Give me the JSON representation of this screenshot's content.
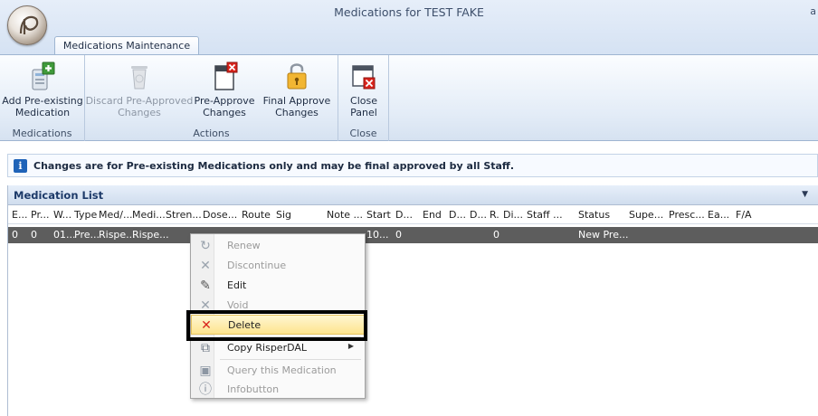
{
  "window": {
    "title": "Medications for TEST FAKE",
    "right_glyph": "a"
  },
  "tabs": [
    {
      "label": "Medications Maintenance"
    }
  ],
  "ribbon": {
    "groups": [
      {
        "label": "Medications",
        "buttons": [
          {
            "label_line1": "Add Pre-existing",
            "label_line2": "Medication",
            "icon": "add-medication-icon",
            "enabled": true
          }
        ]
      },
      {
        "label": "Actions",
        "buttons": [
          {
            "label_line1": "Discard Pre-Approved",
            "label_line2": "Changes",
            "icon": "trash-icon",
            "enabled": false
          },
          {
            "label_line1": "Pre-Approve",
            "label_line2": "Changes",
            "icon": "document-x-icon",
            "enabled": true
          },
          {
            "label_line1": "Final Approve",
            "label_line2": "Changes",
            "icon": "padlock-icon",
            "enabled": true
          }
        ]
      },
      {
        "label": "Close",
        "buttons": [
          {
            "label_line1": "Close",
            "label_line2": "Panel",
            "icon": "close-panel-icon",
            "enabled": true
          }
        ]
      }
    ]
  },
  "infobar": {
    "icon": "info-icon",
    "icon_glyph": "i",
    "text": "Changes are for Pre-existing Medications only and may be final approved by all Staff."
  },
  "medication_list": {
    "title": "Medication List",
    "collapse_glyph": "▼",
    "columns": [
      "E...",
      "Pr...",
      "W...",
      "Type",
      "Med/...",
      "Medi...",
      "Stren...",
      "Dose...",
      "Route",
      "Sig",
      "Note ...",
      "Start",
      "D...",
      "End",
      "D...",
      "D...",
      "R.",
      "Di...",
      "Staff ...",
      "Status",
      "Supe...",
      "Presc...",
      "Ea...",
      "F/A"
    ],
    "selected_row": {
      "cells": [
        "0",
        "0",
        "01...",
        "Pre...",
        "Rispe...",
        "Rispe...",
        "10...",
        "0",
        "0",
        "New Pre..."
      ]
    }
  },
  "context_menu": {
    "items": [
      {
        "label": "Renew",
        "icon": "renew-icon",
        "enabled": false
      },
      {
        "label": "Discontinue",
        "icon": "discontinue-icon",
        "enabled": false
      },
      {
        "label": "Edit",
        "icon": "pencil-icon",
        "enabled": true
      },
      {
        "label": "Void",
        "icon": "void-icon",
        "enabled": false
      },
      {
        "label": "Delete",
        "icon": "delete-icon",
        "enabled": true,
        "highlighted": true
      },
      {
        "label": "Copy RisperDAL",
        "icon": "copy-icon",
        "enabled": true,
        "submenu": true
      },
      {
        "label": "Query this Medication",
        "icon": "query-icon",
        "enabled": false
      },
      {
        "label": "Infobutton",
        "icon": "infobutton-icon",
        "enabled": false
      }
    ]
  },
  "colors": {
    "ribbon_bg": "#e3ecf7",
    "selected_row": "#5d5d5d",
    "highlight_border": "#000000",
    "delete_red": "#d9241c"
  }
}
